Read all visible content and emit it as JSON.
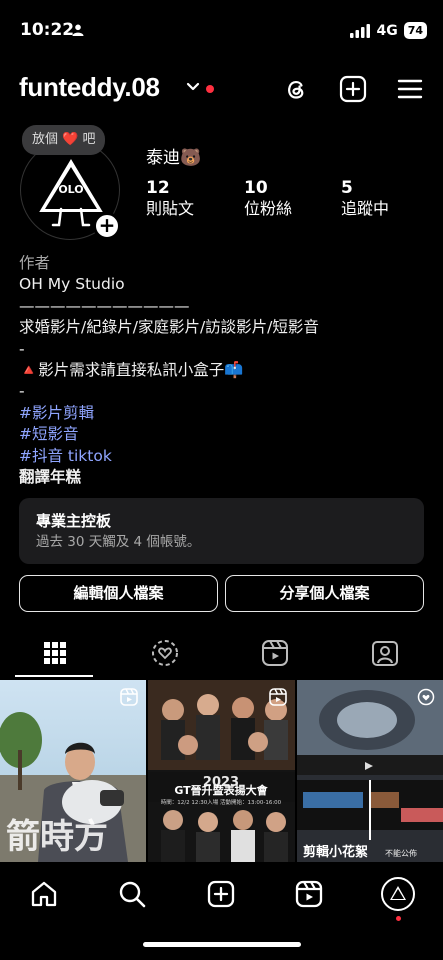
{
  "status_bar": {
    "time": "10:22",
    "network": "4G",
    "battery": "74"
  },
  "header": {
    "username": "funteddy.08"
  },
  "note": {
    "text": "放個 ❤️ 吧"
  },
  "avatar": {
    "logo_text": "OLO"
  },
  "profile": {
    "display_name": "泰迪🐻",
    "stats": [
      {
        "count": "12",
        "label": "則貼文"
      },
      {
        "count": "10",
        "label": "位粉絲"
      },
      {
        "count": "5",
        "label": "追蹤中"
      }
    ]
  },
  "bio": {
    "category": "作者",
    "lines": [
      "OH My  Studio",
      "———————————",
      "求婚影片/紀錄片/家庭影片/訪談影片/短影音",
      "-",
      "🔺影片需求請直接私訊小盒子📫",
      "-"
    ],
    "hashtags": [
      "#影片剪輯",
      "#短影音",
      "#抖音 tiktok"
    ],
    "translate": "翻譯年糕"
  },
  "dashboard": {
    "title": "專業主控板",
    "subtitle": "過去 30 天觸及 4 個帳號。"
  },
  "buttons": {
    "edit": "編輯個人檔案",
    "share": "分享個人檔案"
  },
  "tabs": [
    "grid-icon",
    "reels-heart-icon",
    "reels-icon",
    "tagged-icon"
  ],
  "grid": {
    "items": [
      {
        "caption": ""
      },
      {
        "year": "2023",
        "title": "GT晉升暨表揚大會",
        "detail": "時間：12/2 12:30入場 活動開始：13:00-16:00"
      },
      {
        "caption": "剪輯小花絮",
        "badge": "不能公佈"
      }
    ]
  },
  "bottom_nav": [
    "home-icon",
    "search-icon",
    "create-icon",
    "reels-icon",
    "profile-avatar"
  ],
  "colors": {
    "accent": "#ff3040",
    "link": "#8fa5ff",
    "card": "#1c1c1e"
  }
}
